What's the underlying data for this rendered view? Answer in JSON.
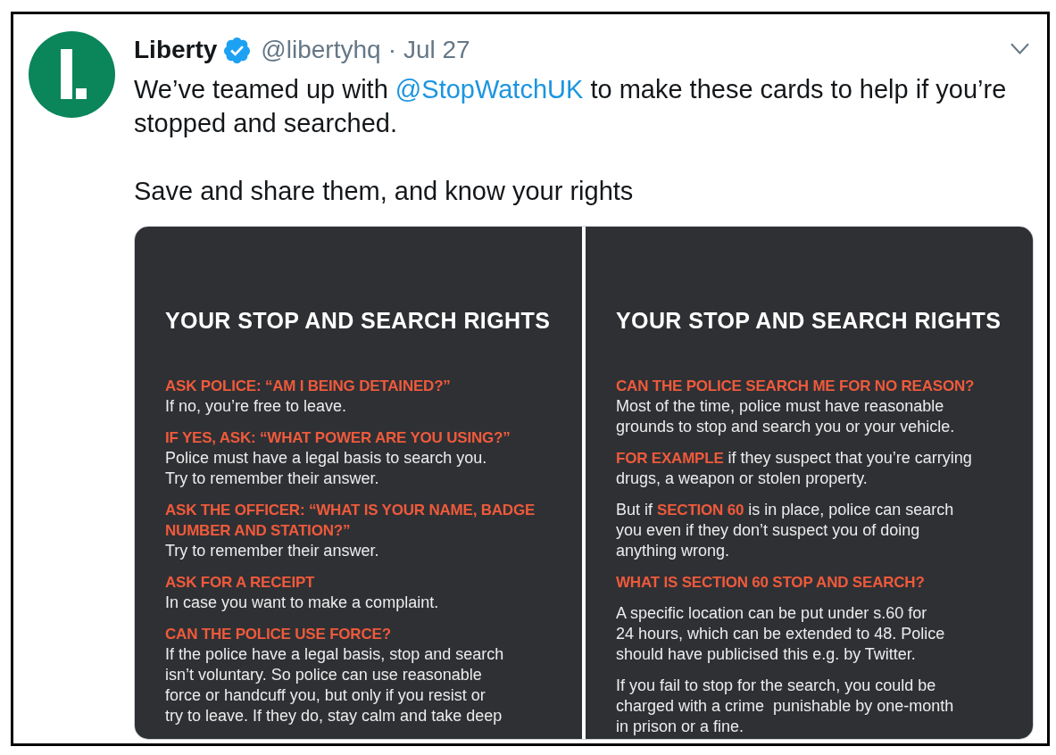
{
  "tweet": {
    "author": {
      "name": "Liberty",
      "verified": true,
      "handle": "@libertyhq"
    },
    "separator": "·",
    "date": "Jul 27",
    "paragraphs": [
      [
        {
          "kind": "text",
          "text": "We’ve teamed up with "
        },
        {
          "kind": "mention",
          "text": "@StopWatchUK"
        },
        {
          "kind": "text",
          "text": " to make these cards to help if you’re stopped and searched."
        }
      ],
      [
        {
          "kind": "text",
          "text": "Save and share them, and know your rights"
        }
      ]
    ],
    "media": {
      "cards": [
        {
          "title": "YOUR STOP AND SEARCH RIGHTS",
          "blocks": [
            {
              "heading": "ASK POLICE: “AM I BEING DETAINED?”",
              "body": "If no, you’re free to leave."
            },
            {
              "heading": "IF YES, ASK: “WHAT POWER ARE YOU USING?”",
              "body": "Police must have a legal basis to search you.\nTry to remember their answer."
            },
            {
              "heading": "ASK THE OFFICER: “WHAT IS YOUR NAME, BADGE\nNUMBER AND STATION?”",
              "body": "Try to remember their answer."
            },
            {
              "heading": "ASK FOR A RECEIPT",
              "body": "In case you want to make a complaint."
            },
            {
              "heading": "CAN THE POLICE USE FORCE?",
              "body": "If the police have a legal basis, stop and search\nisn’t voluntary. So police can use reasonable\nforce or handcuff you, but only if you resist or\ntry to leave. If they do, stay calm and take deep"
            }
          ]
        },
        {
          "title": "YOUR STOP AND SEARCH RIGHTS",
          "blocks": [
            {
              "heading": "CAN THE POLICE SEARCH ME FOR NO REASON?",
              "body": "Most of the time, police must have reasonable\ngrounds to stop and search you or your vehicle."
            },
            {
              "body": "**FOR EXAMPLE** if they suspect that you’re carrying\ndrugs, a weapon or stolen property."
            },
            {
              "body": "But if **SECTION 60** is in place, police can search\nyou even if they don’t suspect you of doing\nanything wrong."
            },
            {
              "heading": "WHAT IS SECTION 60 STOP AND SEARCH?"
            },
            {
              "body": "A specific location can be put under s.60 for\n24 hours, which can be extended to 48. Police\nshould have publicised this e.g. by Twitter."
            },
            {
              "body": "If you fail to stop for the search, you could be\ncharged with a crime  punishable by one-month\nin prison or a fine."
            }
          ]
        }
      ]
    }
  }
}
